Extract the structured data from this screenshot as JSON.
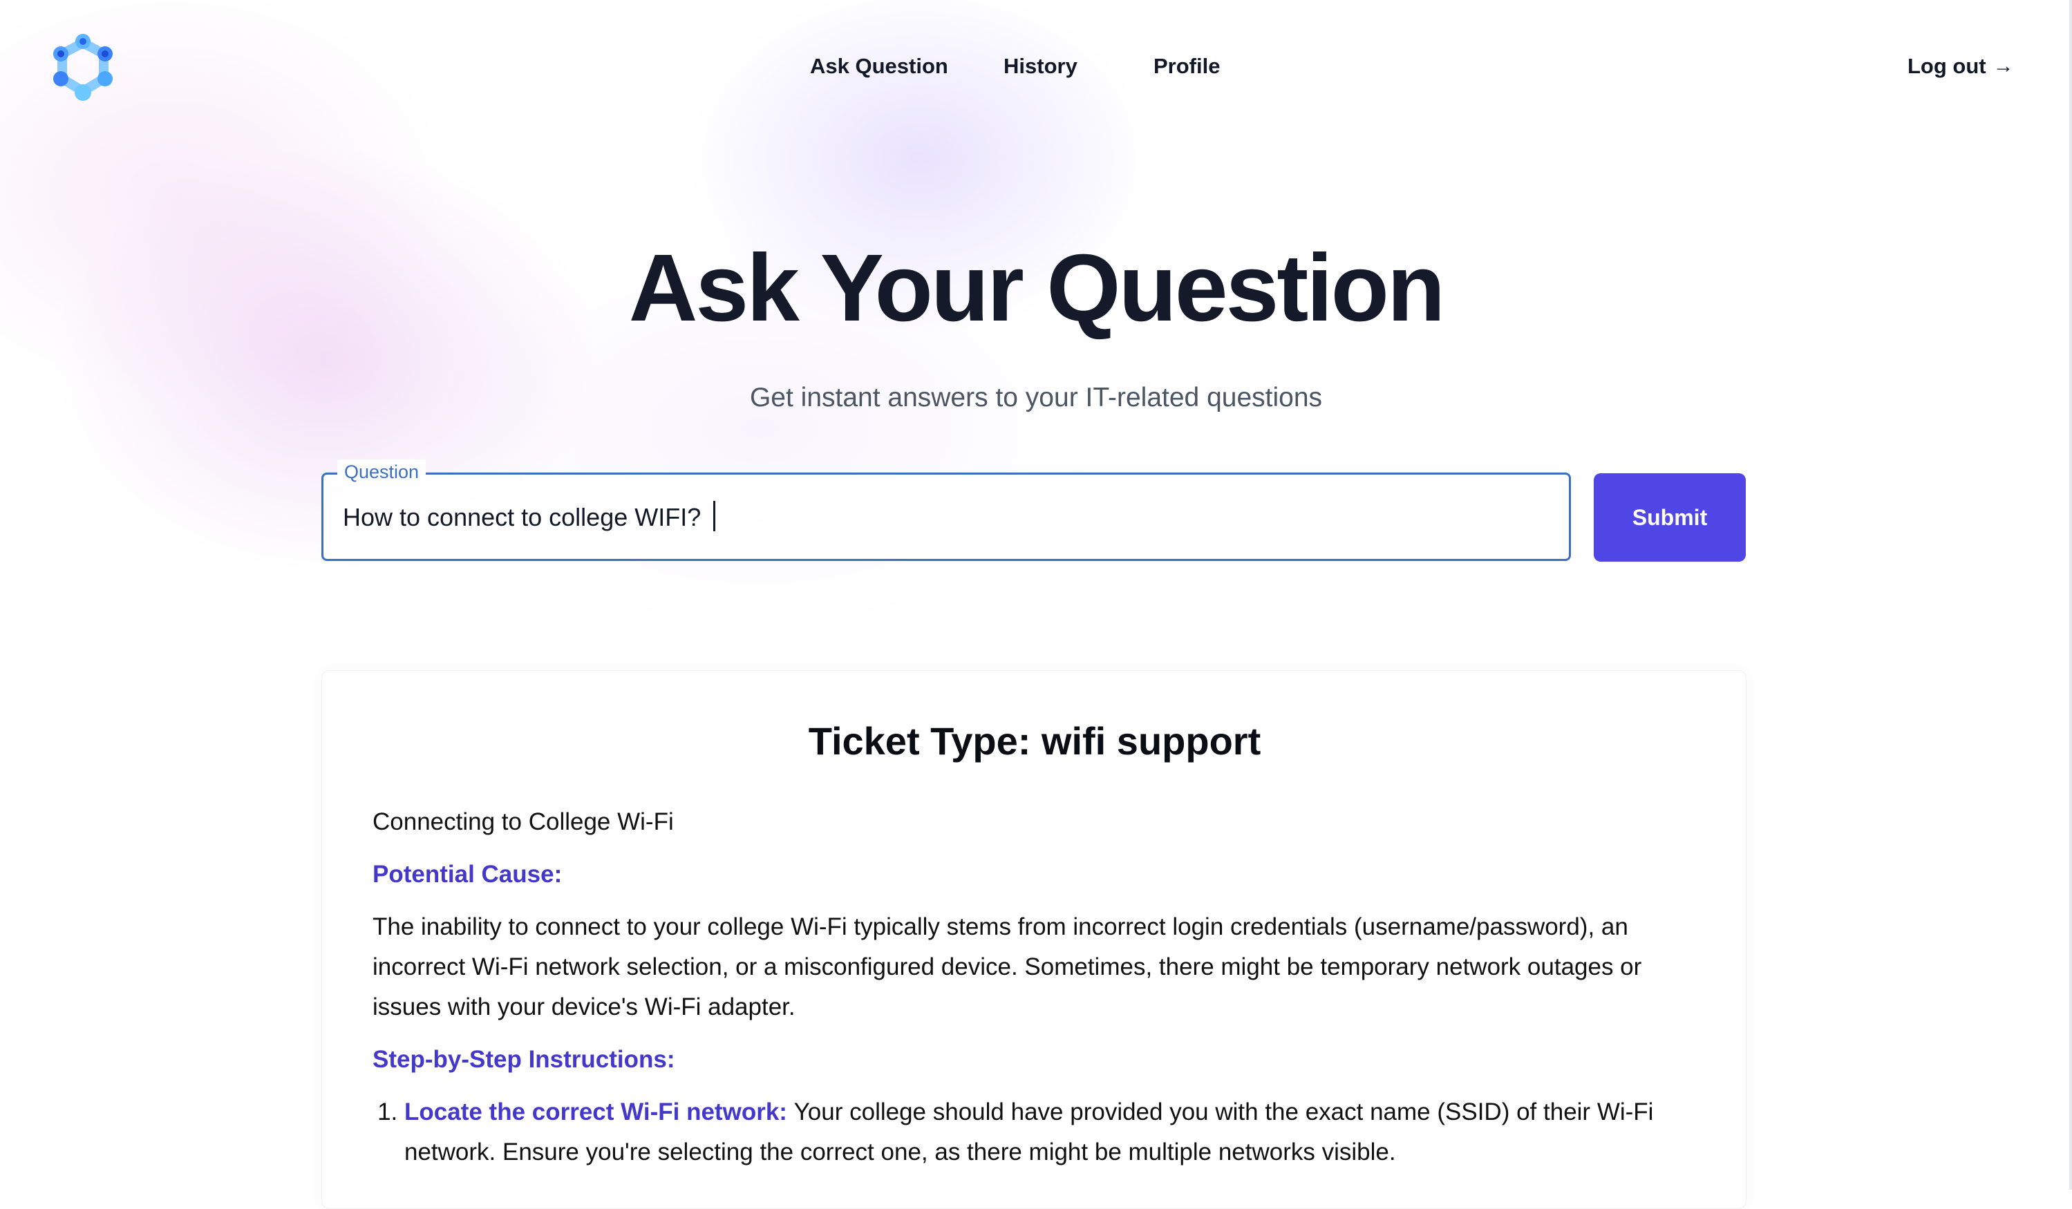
{
  "nav": {
    "items": [
      {
        "label": "Ask Question"
      },
      {
        "label": "History"
      },
      {
        "label": "Profile"
      }
    ],
    "logout_label": "Log out",
    "logout_arrow": "→"
  },
  "hero": {
    "title": "Ask Your Question",
    "subtitle": "Get instant answers to your IT-related questions"
  },
  "question_form": {
    "label": "Question",
    "value": "How to connect to college WIFI?",
    "submit_label": "Submit"
  },
  "answer": {
    "ticket_title": "Ticket Type: wifi support",
    "heading": "Connecting to College Wi-Fi",
    "potential_cause_heading": "Potential Cause:",
    "potential_cause_text": "The inability to connect to your college Wi-Fi typically stems from incorrect login credentials (username/password), an incorrect Wi-Fi network selection, or a misconfigured device. Sometimes, there might be temporary network outages or issues with your device's Wi-Fi adapter.",
    "instructions_heading": "Step-by-Step Instructions:",
    "steps": [
      {
        "title": "Locate the correct Wi-Fi network:",
        "text": "Your college should have provided you with the exact name (SSID) of their Wi-Fi network. Ensure you're selecting the correct one, as there might be multiple networks visible."
      }
    ]
  },
  "colors": {
    "accent": "#4f46e5",
    "heading_accent": "#4338ca",
    "field_border": "#3b6fc4"
  },
  "icons": {
    "logo": "network-nodes-logo",
    "logout": "arrow-right-icon"
  }
}
